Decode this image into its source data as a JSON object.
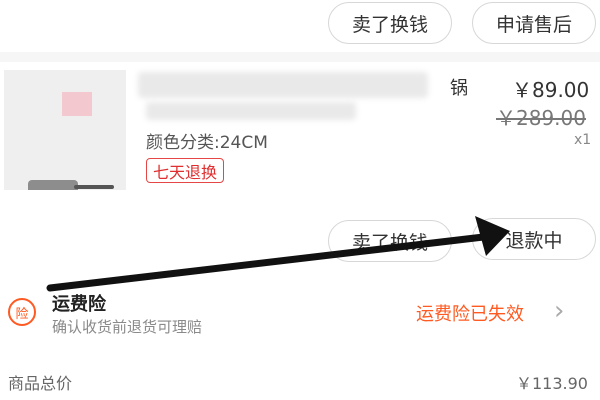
{
  "top_actions": {
    "sell_label": "卖了换钱",
    "after_sale_label": "申请售后"
  },
  "product": {
    "title_fragment": "锅",
    "spec_label": "颜色分类:24CM",
    "return_tag": "七天退换",
    "price": "￥89.00",
    "original_price": "￥289.00",
    "quantity": "x1"
  },
  "item_actions": {
    "sell_label": "卖了换钱",
    "refund_label": "退款中"
  },
  "shipping_insurance": {
    "icon_text": "险",
    "title": "运费险",
    "subtitle": "确认收货前退货可理赔",
    "status": "运费险已失效",
    "chevron": "›"
  },
  "summary": {
    "label": "商品总价",
    "value": "￥113.90"
  },
  "colors": {
    "accent": "#ff5a22",
    "tag_red": "#e02e2e",
    "arrow": "#111111"
  }
}
